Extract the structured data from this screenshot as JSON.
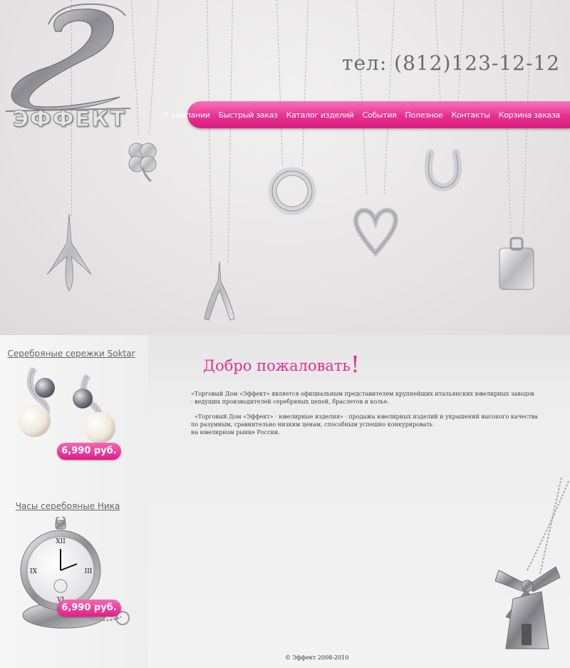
{
  "header": {
    "logo_text": "ЭФФЕКТ",
    "phone": "тел: (812)123-12-12"
  },
  "nav": {
    "items": [
      {
        "label": "О компании"
      },
      {
        "label": "Быстрый заказ"
      },
      {
        "label": "Каталог изделий"
      },
      {
        "label": "События"
      },
      {
        "label": "Полезное"
      },
      {
        "label": "Контакты"
      },
      {
        "label": "Корзина заказа"
      }
    ]
  },
  "sidebar": {
    "promos": [
      {
        "title": "Серебряные сережки Soktar",
        "price": "6,990 руб."
      },
      {
        "title": "Часы серебряные Ника",
        "price": "6,990 руб."
      }
    ]
  },
  "content": {
    "welcome": "Добро пожаловать",
    "welcome_mark": "!",
    "p1_line1": "«Торговый Дом «Эффект» является официальным представителем крупнейших итальянских ювелирных заводов",
    "p1_line2": "· ведущих производителей серебряных цепей,  браслетов и колье.",
    "p2_line1": "  «Торговый Дом «Эффект» · ювелирные изделия» · продажа ювелирных изделий и украшений высокого качества",
    "p2_line2": "по разумным, сравнительно низким ценам, способным успешно конкурировать",
    "p2_line3": "на ювелирном рынке России."
  },
  "footer": {
    "copyright": "© Эффект 2008-2010"
  },
  "colors": {
    "accent": "#e8288f",
    "text_gray": "#6b6b6b"
  }
}
